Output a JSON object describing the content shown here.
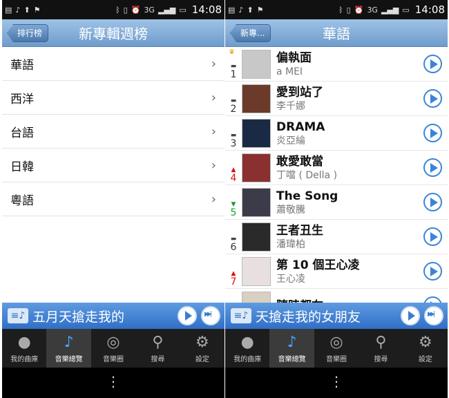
{
  "status": {
    "time": "14:08",
    "net": "3G"
  },
  "left": {
    "back_label": "排行榜",
    "title": "新專輯週榜",
    "categories": [
      "華語",
      "西洋",
      "台語",
      "日韓",
      "粵語"
    ]
  },
  "right": {
    "back_label": "新專...",
    "title": "華語",
    "songs": [
      {
        "rank": "1",
        "trend": "same",
        "title": "偏執面",
        "artist": "a MEI"
      },
      {
        "rank": "2",
        "trend": "same",
        "title": "愛到站了",
        "artist": "李千娜"
      },
      {
        "rank": "3",
        "trend": "same",
        "title": "DRAMA",
        "artist": "炎亞綸"
      },
      {
        "rank": "4",
        "trend": "up",
        "title": "敢愛敢當",
        "artist": "丁噹 ( Della )"
      },
      {
        "rank": "5",
        "trend": "down",
        "title": "The Song",
        "artist": "蕭敬騰"
      },
      {
        "rank": "6",
        "trend": "same",
        "title": "王者丑生",
        "artist": "潘瑋柏"
      },
      {
        "rank": "7",
        "trend": "up",
        "title": "第 10 個王心凌",
        "artist": "王心凌"
      },
      {
        "rank": "",
        "trend": "",
        "title": "隨時都在",
        "artist": ""
      }
    ]
  },
  "player": {
    "left_text": "五月天搶走我的",
    "right_text": "天搶走我的女朋友"
  },
  "tabs": [
    "我的曲庫",
    "音樂總覽",
    "音樂圈",
    "搜尋",
    "設定"
  ],
  "menu_glyph": "⋮"
}
